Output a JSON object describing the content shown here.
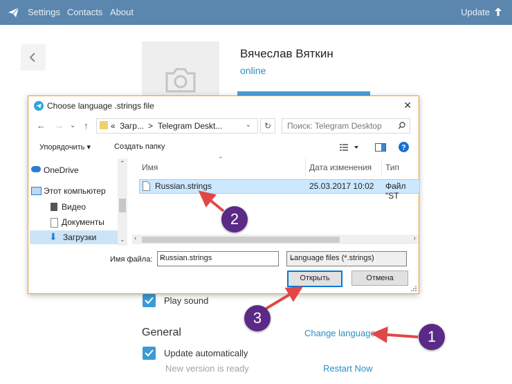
{
  "topbar": {
    "nav": [
      "Settings",
      "Contacts",
      "About"
    ],
    "update_label": "Update"
  },
  "profile": {
    "name": "Вячеслав Вяткин",
    "status": "online"
  },
  "notifications": {
    "play_sound_label": "Play sound",
    "play_sound_checked": true
  },
  "general": {
    "title": "General",
    "change_language": "Change language",
    "update_automatically_label": "Update automatically",
    "update_automatically_checked": true,
    "new_version": "New version is ready",
    "restart_now": "Restart Now"
  },
  "dialog": {
    "title": "Choose language .strings file",
    "address": {
      "prefix": "«",
      "part1": "Загр...",
      "sep": ">",
      "part2": "Telegram Deskt..."
    },
    "search_placeholder": "Поиск: Telegram Desktop",
    "toolbar": {
      "organize": "Упорядочить ▾",
      "new_folder": "Создать папку"
    },
    "sidebar": [
      "OneDrive",
      "Этот компьютер",
      "Видео",
      "Документы",
      "Загрузки"
    ],
    "columns": {
      "name": "Имя",
      "date": "Дата изменения",
      "type": "Тип"
    },
    "file": {
      "name": "Russian.strings",
      "date": "25.03.2017 10:02",
      "type": "Файл \"ST"
    },
    "filename_label": "Имя файла:",
    "filename_value": "Russian.strings",
    "filetype_value": "Language files (*.strings)",
    "open_label": "Открыть",
    "cancel_label": "Отмена"
  },
  "callouts": [
    "1",
    "2",
    "3"
  ],
  "colors": {
    "topbar": "#5b86ad",
    "link": "#2a8fc2",
    "checkbox": "#3a9bd5",
    "callout": "#5a2a86",
    "arrow": "#e04848"
  }
}
